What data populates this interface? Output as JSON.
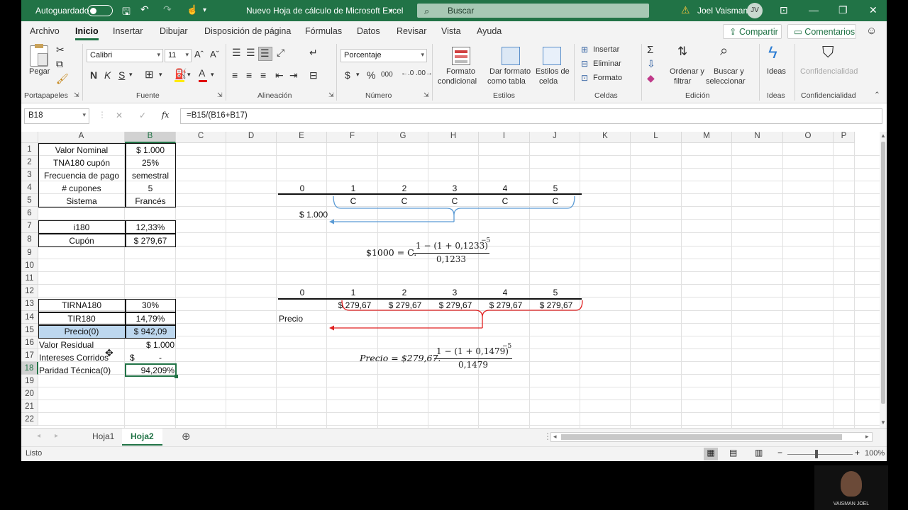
{
  "titlebar": {
    "autosave_label": "Autoguardado",
    "doc_title": "Nuevo Hoja de cálculo de Microsoft Excel",
    "search_placeholder": "Buscar",
    "warning_icon": "warning-icon",
    "user_name": "Joel Vaisman",
    "user_initials": "JV",
    "accent": "#217346"
  },
  "menu": {
    "tabs": [
      "Archivo",
      "Inicio",
      "Insertar",
      "Dibujar",
      "Disposición de página",
      "Fórmulas",
      "Datos",
      "Revisar",
      "Vista",
      "Ayuda"
    ],
    "active": "Inicio",
    "share_label": "Compartir",
    "comments_label": "Comentarios"
  },
  "ribbon": {
    "clipboard": {
      "paste_label": "Pegar",
      "group_label": "Portapapeles"
    },
    "font": {
      "font_name": "Calibri",
      "font_size": "11",
      "bold": "N",
      "italic": "K",
      "underline": "S",
      "group_label": "Fuente"
    },
    "alignment": {
      "group_label": "Alineación"
    },
    "number": {
      "format": "Porcentaje",
      "currency_symbol": "$",
      "percent_symbol": "%",
      "thousands_symbol": "000",
      "group_label": "Número"
    },
    "styles": {
      "conditional_l1": "Formato",
      "conditional_l2": "condicional",
      "astable_l1": "Dar formato",
      "astable_l2": "como tabla",
      "cellstyles_l1": "Estilos de",
      "cellstyles_l2": "celda",
      "group_label": "Estilos"
    },
    "cells": {
      "insert": "Insertar",
      "delete": "Eliminar",
      "format": "Formato",
      "group_label": "Celdas"
    },
    "editing": {
      "sort_l1": "Ordenar y",
      "sort_l2": "filtrar",
      "find_l1": "Buscar y",
      "find_l2": "seleccionar",
      "group_label": "Edición"
    },
    "ideas": {
      "label": "Ideas",
      "group_label": "Ideas"
    },
    "sensitivity": {
      "label": "Confidencialidad",
      "group_label": "Confidencialidad"
    }
  },
  "formula_bar": {
    "name_box": "B18",
    "cancel": "✕",
    "enter": "✓",
    "fx": "fx",
    "formula": "=B15/(B16+B17)"
  },
  "columns": [
    "A",
    "B",
    "C",
    "D",
    "E",
    "F",
    "G",
    "H",
    "I",
    "J",
    "K",
    "L",
    "M",
    "N",
    "O",
    "P"
  ],
  "rows": [
    "1",
    "2",
    "3",
    "4",
    "5",
    "6",
    "7",
    "8",
    "9",
    "10",
    "11",
    "12",
    "13",
    "14",
    "15",
    "16",
    "17",
    "18",
    "19",
    "20",
    "21",
    "22"
  ],
  "cells": {
    "A1": "Valor Nominal",
    "B1": "$ 1.000",
    "A2": "TNA180 cupón",
    "B2": "25%",
    "A3": "Frecuencia de pago",
    "B3": "semestral",
    "A4": "# cupones",
    "B4": "5",
    "A5": "Sistema",
    "B5": "Francés",
    "A7": "i180",
    "B7": "12,33%",
    "A8": "Cupón",
    "B8": "$ 279,67",
    "A13": "TIRNA180",
    "B13": "30%",
    "A14": "TIR180",
    "B14": "14,79%",
    "A15": "Precio(0)",
    "B15": "$ 942,09",
    "A16": "Valor Residual",
    "B16": "$ 1.000",
    "A17": "Intereses Corridos",
    "B17a": "$",
    "B17b": "-",
    "A18": "Paridad Técnica(0)",
    "B18": "94,209%"
  },
  "timeline1": {
    "periods": [
      "0",
      "1",
      "2",
      "3",
      "4",
      "5"
    ],
    "coupons": [
      "C",
      "C",
      "C",
      "C",
      "C"
    ],
    "pv_label": "$ 1.000"
  },
  "equation1": {
    "lhs": "$1000 = C.",
    "numerator": "1 − (1 + 0,1233)",
    "exponent": "−5",
    "denominator": "0,1233"
  },
  "timeline2": {
    "periods": [
      "0",
      "1",
      "2",
      "3",
      "4",
      "5"
    ],
    "coupons": [
      "$ 279,67",
      "$ 279,67",
      "$ 279,67",
      "$ 279,67",
      "$ 279,67"
    ],
    "price_label": "Precio"
  },
  "equation2": {
    "lhs": "Precio = $279,67.",
    "numerator": "1 − (1 + 0,1479)",
    "exponent": "−5",
    "denominator": "0,1479"
  },
  "sheets": {
    "tabs": [
      "Hoja1",
      "Hoja2"
    ],
    "active": "Hoja2"
  },
  "status": {
    "ready": "Listo",
    "zoom": "100%"
  },
  "webcam": {
    "name": "VAISMAN JOEL"
  },
  "colors": {
    "blue_bracket": "#5b9bd5",
    "red_bracket": "#e02020",
    "selected_fill": "#bdd7ee"
  }
}
